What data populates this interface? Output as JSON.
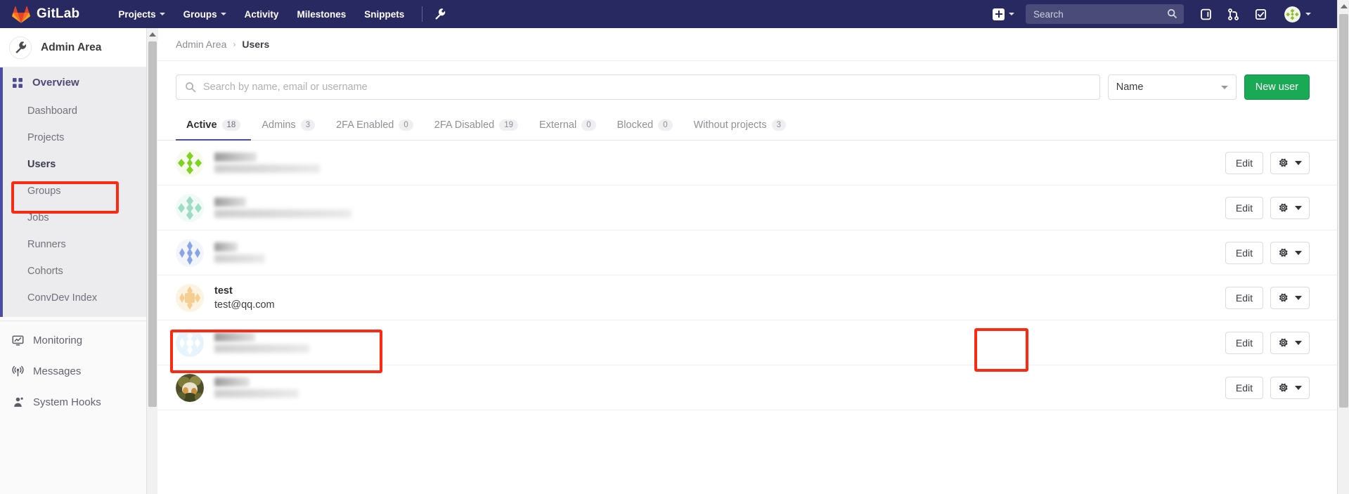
{
  "navbar": {
    "brand": "GitLab",
    "logo_icon": "gitlab-tanuki-logo",
    "links": [
      {
        "label": "Projects",
        "icon": "chevron-down-icon",
        "has_caret": true
      },
      {
        "label": "Groups",
        "icon": "chevron-down-icon",
        "has_caret": true
      },
      {
        "label": "Activity",
        "has_caret": false
      },
      {
        "label": "Milestones",
        "has_caret": false
      },
      {
        "label": "Snippets",
        "has_caret": false
      }
    ],
    "admin_wrench_icon": "wrench-icon",
    "new_menu_icon": "plus-square-icon",
    "new_menu_caret_icon": "chevron-down-icon",
    "search": {
      "placeholder": "Search",
      "value": "",
      "icon": "search-icon"
    },
    "icons": [
      {
        "name": "issues-icon",
        "title": "Issues"
      },
      {
        "name": "merge-requests-icon",
        "title": "Merge requests"
      },
      {
        "name": "todos-icon",
        "title": "Todos"
      }
    ],
    "user_avatar_icon": "user-avatar-identicon",
    "user_caret_icon": "chevron-down-icon"
  },
  "sidebar": {
    "header": {
      "title": "Admin Area",
      "icon": "wrench-icon"
    },
    "overview": {
      "label": "Overview",
      "icon": "grid-overview-icon"
    },
    "sub_items": [
      {
        "label": "Dashboard",
        "current": false
      },
      {
        "label": "Projects",
        "current": false
      },
      {
        "label": "Users",
        "current": true
      },
      {
        "label": "Groups",
        "current": false
      },
      {
        "label": "Jobs",
        "current": false
      },
      {
        "label": "Runners",
        "current": false
      },
      {
        "label": "Cohorts",
        "current": false
      },
      {
        "label": "ConvDev Index",
        "current": false
      }
    ],
    "items": [
      {
        "label": "Monitoring",
        "icon": "monitor-icon"
      },
      {
        "label": "Messages",
        "icon": "broadcast-icon"
      },
      {
        "label": "System Hooks",
        "icon": "hook-icon"
      }
    ]
  },
  "breadcrumb": {
    "root": "Admin Area",
    "separator": "›",
    "current": "Users"
  },
  "toolbar": {
    "search": {
      "placeholder": "Search by name, email or username",
      "value": "",
      "icon": "search-icon"
    },
    "sort": {
      "selected": "Name",
      "caret_icon": "chevron-down-icon"
    },
    "new_user_label": "New user"
  },
  "tabs": [
    {
      "label": "Active",
      "count": "18",
      "active": true
    },
    {
      "label": "Admins",
      "count": "3",
      "active": false
    },
    {
      "label": "2FA Enabled",
      "count": "0",
      "active": false
    },
    {
      "label": "2FA Disabled",
      "count": "19",
      "active": false
    },
    {
      "label": "External",
      "count": "0",
      "active": false
    },
    {
      "label": "Blocked",
      "count": "0",
      "active": false
    },
    {
      "label": "Without projects",
      "count": "3",
      "active": false
    }
  ],
  "row_actions": {
    "edit_label": "Edit",
    "gear_icon": "gear-icon",
    "caret_icon": "caret-down-icon"
  },
  "users": [
    {
      "name": "",
      "email": "",
      "redacted": true,
      "avatar": "identicon-green",
      "name_w": 60,
      "mail_w": 150
    },
    {
      "name": "",
      "email": "",
      "redacted": true,
      "avatar": "identicon-teal",
      "name_w": 45,
      "mail_w": 195
    },
    {
      "name": "",
      "email": "",
      "redacted": true,
      "avatar": "identicon-blue",
      "name_w": 33,
      "mail_w": 72
    },
    {
      "name": "test",
      "email": "test@qq.com",
      "redacted": false,
      "avatar": "identicon-orange",
      "highlighted": true
    },
    {
      "name": "",
      "email": "",
      "redacted": true,
      "avatar": "identicon-lightblue",
      "name_w": 58,
      "mail_w": 135
    },
    {
      "name": "",
      "email": "",
      "redacted": true,
      "avatar": "photo-cat",
      "name_w": 50,
      "mail_w": 120
    }
  ],
  "annotations": [
    {
      "name": "annotation-sidebar-users",
      "target": "Users sidebar item",
      "color": "#fc2a12"
    },
    {
      "name": "annotation-test-user-row",
      "target": "test user entry",
      "color": "#fc2a12"
    },
    {
      "name": "annotation-edit-button",
      "target": "Edit button for test user",
      "color": "#fc2a12"
    }
  ],
  "colors": {
    "navbar_bg": "#292961",
    "sidebar_bg": "#fafafa",
    "accent_purple": "#4b4ba3",
    "green_button": "#1aaa55",
    "annotation_red": "#fc2a12"
  }
}
